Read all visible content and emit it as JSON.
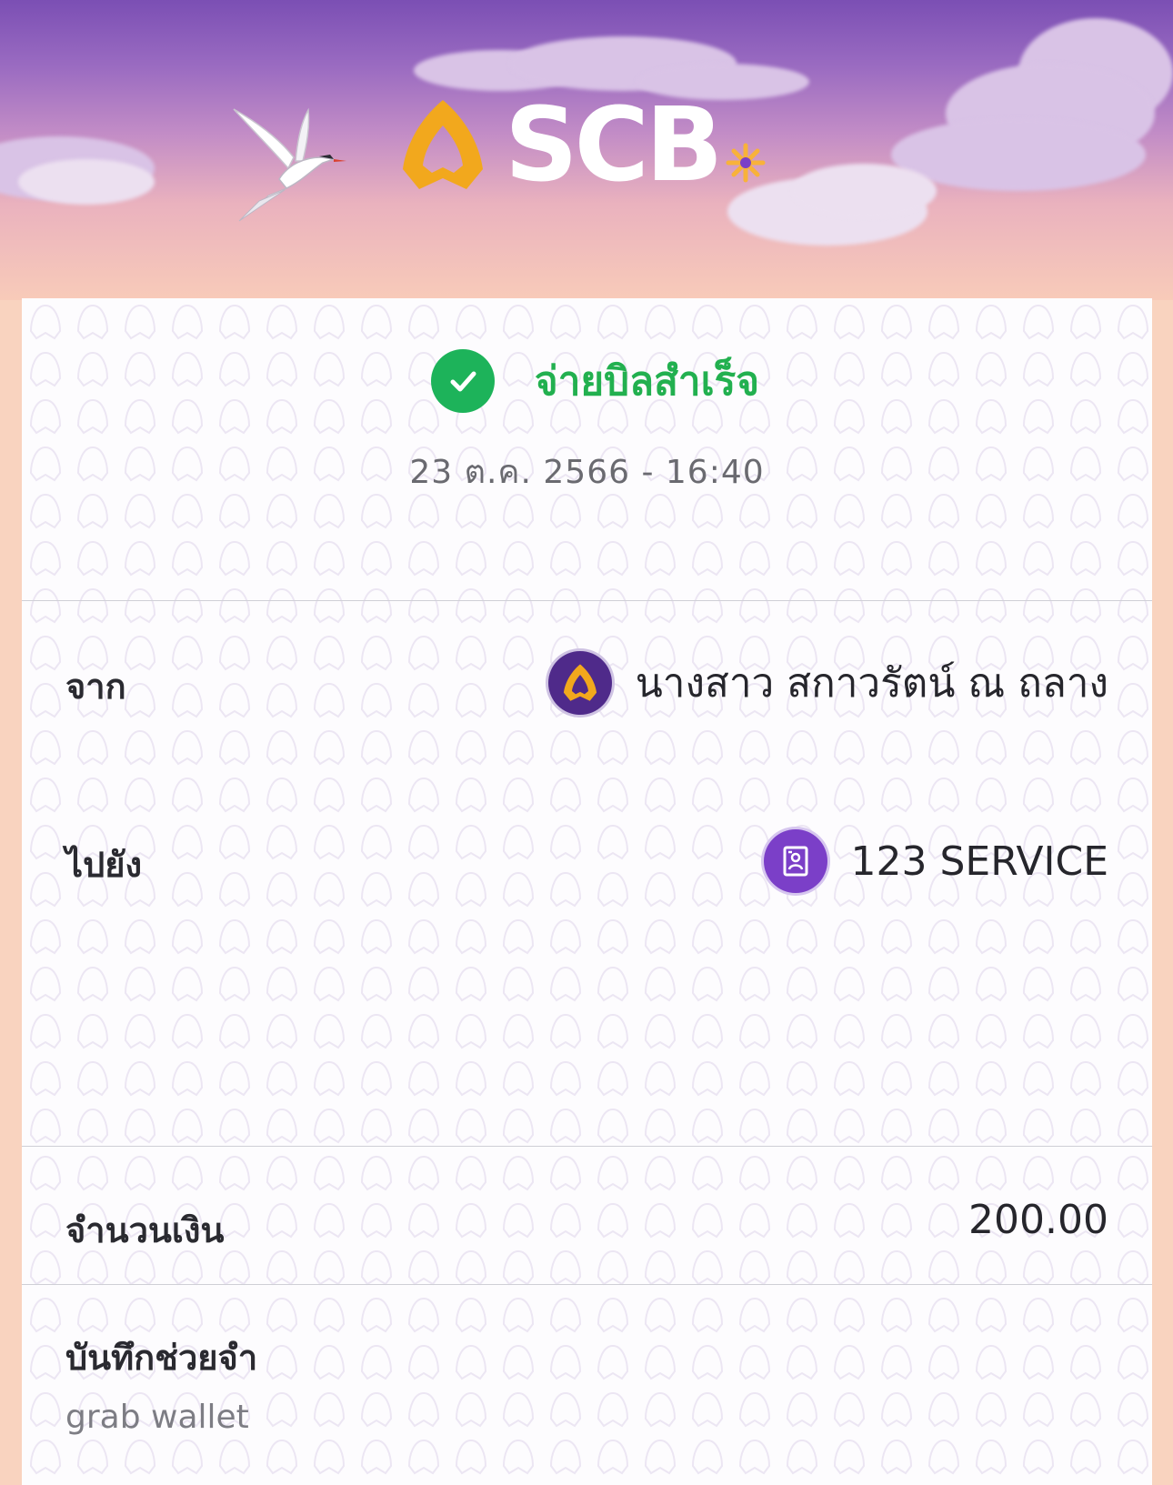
{
  "header": {
    "brand": "SCB"
  },
  "receipt": {
    "status": "จ่ายบิลสำเร็จ",
    "datetime": "23 ต.ค. 2566 - 16:40",
    "from_label": "จาก",
    "from_name": "นางสาว สกาวรัตน์ ณ ถลาง",
    "to_label": "ไปยัง",
    "to_name": "123 SERVICE",
    "amount_label": "จำนวนเงิน",
    "amount": "200.00",
    "memo_label": "บันทึกช่วยจำ",
    "memo": "grab wallet"
  },
  "colors": {
    "brand_purple": "#4f2a8a",
    "success_green": "#22b04f",
    "logo_gold": "#f2a81d"
  }
}
